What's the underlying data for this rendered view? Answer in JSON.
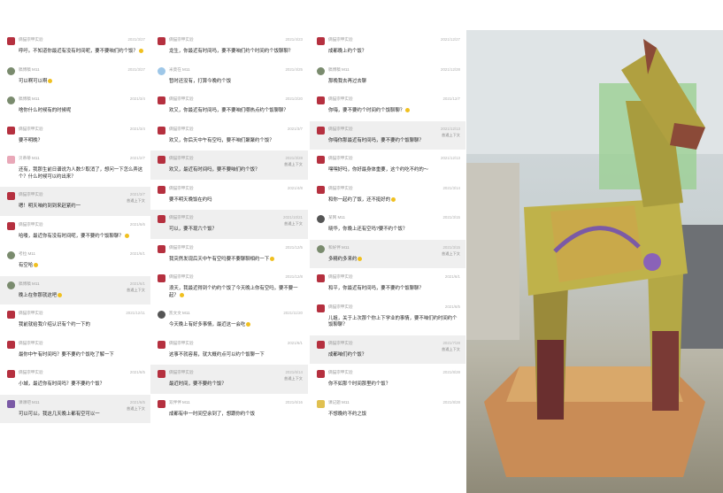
{
  "columns": [
    {
      "messages": [
        {
          "avatar": "c1",
          "nick": "俩猫宗甲实验",
          "time": "2021/3/27",
          "text": "呼吁。不知道你最近有没有时间呢，要不要咱们约个饭？",
          "emoji": true
        },
        {
          "avatar": "c2",
          "nick": "稿博稿 M11",
          "time": "2021/3/27",
          "text": "可以啊可以啊",
          "emoji": true
        },
        {
          "avatar": "c2",
          "nick": "稿博稿 M11",
          "time": "2021/3/4",
          "text": "啥你什么时候有的时候呢"
        },
        {
          "avatar": "c1",
          "nick": "俩猫宗甲实验",
          "time": "2021/3/4",
          "text": "要不明晚？"
        },
        {
          "avatar": "c3",
          "nick": "贝蒂蒂 M11",
          "time": "2021/2/7",
          "text": "还有，我那生前日谱说为人数少取消了，想问一下怎么弄这个？什么时候可以约出来？"
        },
        {
          "avatar": "c1",
          "nick": "俩猫宗甲实验",
          "time": "2021/3/7",
          "tag": "普通上下文",
          "text": "嗯！明天咱约到到来赶紧约一",
          "hl": true
        },
        {
          "avatar": "c1",
          "nick": "俩猫宗甲实验",
          "time": "2021/6/6",
          "text": "哈喽，最近你有没有时间呢，要不要约个饭聊聊？",
          "emoji": true
        },
        {
          "avatar": "c2",
          "nick": "考拉 M11",
          "time": "2021/6/1",
          "text": "有空哈",
          "emoji": true
        },
        {
          "avatar": "c2",
          "nick": "稿博稿 M11",
          "time": "2021/6/1",
          "tag": "普通上下文",
          "text": "晚上在你那就这吧",
          "emoji": true,
          "hl": true
        },
        {
          "avatar": "c1",
          "nick": "俩猫宗甲实验",
          "time": "2021/12/11",
          "text": "我前就给我介绍认识有个约一下的"
        },
        {
          "avatar": "c1",
          "nick": "俩猫宗甲实验",
          "time": "",
          "text": "最你中午有时间吗？要不要约个饭吃了解一下"
        },
        {
          "avatar": "c1",
          "nick": "俩猫宗甲实验",
          "time": "2021/6/5",
          "text": "小城，最近你有时间吗？要不要约个饭？"
        },
        {
          "avatar": "c7",
          "nick": "课课吧 M11",
          "time": "2021/6/5",
          "tag": "普通上下文",
          "text": "可以可以。我这几天晚上都有空可以一",
          "hl": true
        }
      ]
    },
    {
      "messages": [
        {
          "avatar": "c1",
          "nick": "俩猫宗甲实验",
          "time": "2021/4/23",
          "text": "龙生，你最近有时间吗，要不要咱们约个时间约个饭聊聊？",
          "emoji": false
        },
        {
          "avatar": "c4",
          "nick": "米莫在 M11",
          "time": "2021/4/25",
          "text": "暂时还没有，打算今晚约个饭"
        },
        {
          "avatar": "c1",
          "nick": "俩猫宗甲实验",
          "time": "2021/2/20",
          "text": "欢又，你最近有时间吗，要不要咱们哪热点约个饭聊聊？"
        },
        {
          "avatar": "c1",
          "nick": "俩猫宗甲实验",
          "time": "2021/3/7",
          "text": "欢又，你后天中午有空吗，要不咱们聚聚约个饭？"
        },
        {
          "avatar": "c1",
          "nick": "俩猫宗甲实验",
          "time": "2021/3/28",
          "tag": "普通上下文",
          "text": "欢又，最近有时间吗，要不要咱们约个饭？",
          "hl": true
        },
        {
          "avatar": "c1",
          "nick": "俩猫宗甲实验",
          "time": "2021/4/8",
          "text": "要不明天晚饭在约吗"
        },
        {
          "avatar": "c1",
          "nick": "俩猫宗甲实验",
          "time": "2021/10/21",
          "tag": "普通上下文",
          "text": "可以，要不现六个饭？",
          "hl": true
        },
        {
          "avatar": "c1",
          "nick": "俩猫宗甲实验",
          "time": "2021/12/5",
          "text": "我突然发现后天中午有空吗要不要聊聊相约一下",
          "emoji": true
        },
        {
          "avatar": "c1",
          "nick": "俩猫宗甲实验",
          "time": "2021/12/8",
          "text": "浪天，我最近得到个约约个饭了今天晚上你有空吗，要不要一起？",
          "emoji": true
        },
        {
          "avatar": "c6",
          "nick": "凯文文 M11",
          "time": "2021/11/20",
          "text": "今天晚上有好多事情，最近这一会吃",
          "emoji": true
        },
        {
          "avatar": "c1",
          "nick": "俩猫宗甲实验",
          "time": "2021/6/1",
          "text": "这事不就容易，就大概约点可以约个饭聊一下"
        },
        {
          "avatar": "c1",
          "nick": "俩猫宗甲实验",
          "time": "2021/6/14",
          "tag": "普通上下文",
          "text": "最近时间，要不要约个饭？",
          "hl": true
        },
        {
          "avatar": "c1",
          "nick": "双伴伴 M11",
          "time": "2021/6/16",
          "text": "成都有中一时间空余到了，想跟你约个饭"
        }
      ]
    },
    {
      "messages": [
        {
          "avatar": "c1",
          "nick": "俩猫宗甲实验",
          "time": "2021/12/27",
          "text": "成都晚上约个饭？"
        },
        {
          "avatar": "c2",
          "nick": "稿博稿 M11",
          "time": "2021/12/28",
          "text": "那晚我去再过去聊"
        },
        {
          "avatar": "c1",
          "nick": "俩猫宗甲实验",
          "time": "2021/12/7",
          "text": "你嗨，要不要约个时间约个饭聊聊？",
          "emoji": true
        },
        {
          "avatar": "c1",
          "nick": "俩猫宗甲实验",
          "time": "2021/12/13",
          "tag": "普通上下文",
          "text": "你嗨你那最近有时间吗，要不要约个饭聊聊？",
          "hl": true
        },
        {
          "avatar": "c1",
          "nick": "俩猫宗甲实验",
          "time": "2021/12/13",
          "text": "嘿嘿好吗，你好最身体重要，这个约吃不约的～"
        },
        {
          "avatar": "c1",
          "nick": "俩猫宗甲实验",
          "time": "2021/3/14",
          "text": "和你一起约了饭，还不挺好的",
          "emoji": true
        },
        {
          "avatar": "c6",
          "nick": "某网 M11",
          "time": "2021/3/15",
          "text": "晓华，你晚上还有空吗?要不约个饭？"
        },
        {
          "avatar": "c2",
          "nick": "和好伴 M11",
          "time": "2021/3/15",
          "tag": "普通上下文",
          "text": "多精约多来约",
          "emoji": true,
          "hl": true
        },
        {
          "avatar": "c1",
          "nick": "俩猫宗甲实验",
          "time": "2021/6/1",
          "text": "和平，你最近有时间吗，要不要约个饭聊聊？"
        },
        {
          "avatar": "c1",
          "nick": "俩猫宗甲实验",
          "time": "2021/6/5",
          "text": "儿姐，关于上次那个你上下学业的事情，要不咱们约时间约个饭聊聊？"
        },
        {
          "avatar": "c1",
          "nick": "俩猫宗甲实验",
          "time": "2021/7/28",
          "tag": "普通上下文",
          "text": "成都咱们约个饭？",
          "hl": true
        },
        {
          "avatar": "c1",
          "nick": "俩猫宗甲实验",
          "time": "2021/8/28",
          "text": "你不如那个时间那里约个饭？"
        },
        {
          "avatar": "c5",
          "nick": "课记题 M11",
          "time": "2021/8/28",
          "text": "不想晚约不约之饭"
        }
      ]
    }
  ],
  "photo": {
    "description_icon": "origami-llama-photo"
  },
  "colors": {
    "highlight": "#efefef",
    "green_text": "#07c160",
    "avatar_red": "#b5303f"
  }
}
